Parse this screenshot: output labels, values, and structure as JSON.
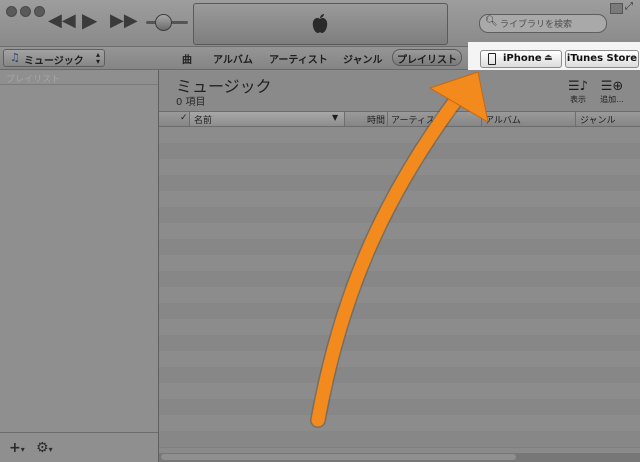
{
  "toolbar": {
    "search_placeholder": "ライブラリを検索",
    "controls": {
      "prev": "◀◀",
      "play": "▶",
      "next": "▶▶"
    }
  },
  "tabbar": {
    "source_label": "ミュージック",
    "tabs": [
      "曲",
      "アルバム",
      "アーティスト",
      "ジャンル",
      "プレイリスト"
    ],
    "device_label": "iPhone",
    "store_label": "iTunes Store"
  },
  "sidebar": {
    "header": "プレイリスト",
    "add_label": "+",
    "gear_label": "⚙"
  },
  "main": {
    "title": "ミュージック",
    "subtitle": "0 項目",
    "tools": [
      {
        "label": "表示",
        "icon": "list-view-icon"
      },
      {
        "label": "追加...",
        "icon": "add-list-icon"
      }
    ],
    "columns": {
      "check": "✓",
      "name": "名前",
      "time": "時間",
      "artist": "アーティスト",
      "album": "アルバム",
      "genre": "ジャンル"
    }
  },
  "colors": {
    "arrow": "#f38a1d",
    "highlight": "#f4f4f4",
    "chrome": "#8a8a8a"
  }
}
